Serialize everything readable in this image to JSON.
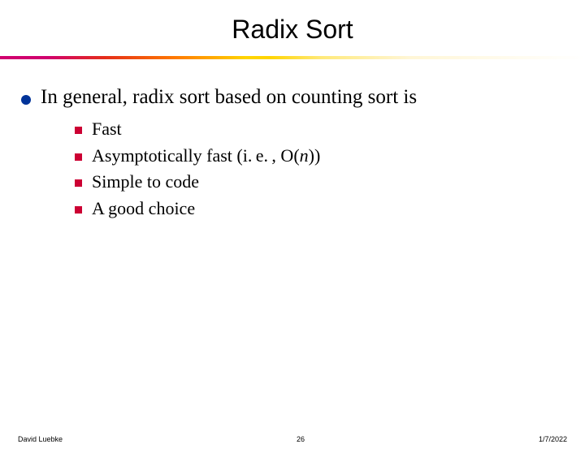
{
  "title": "Radix Sort",
  "top_bullet": "In general, radix sort based on counting sort is",
  "sub_items": [
    "Fast",
    "Asymptotically fast (i. e. , O(<i>n</i>))",
    "Simple to code",
    "A good choice"
  ],
  "footer": {
    "author": "David Luebke",
    "page": "26",
    "date": "1/7/2022"
  }
}
